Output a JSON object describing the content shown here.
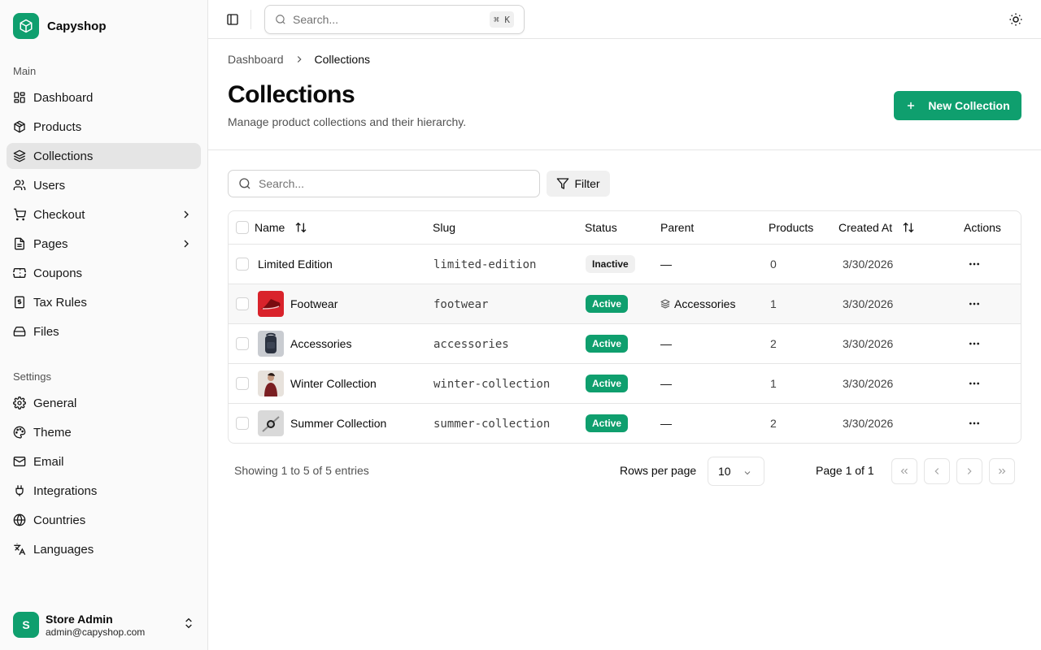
{
  "brand": {
    "name": "Capyshop",
    "color": "#0f9f6e"
  },
  "sidebar": {
    "main_label": "Main",
    "main_items": [
      {
        "label": "Dashboard",
        "icon": "dashboard-icon"
      },
      {
        "label": "Products",
        "icon": "package-icon"
      },
      {
        "label": "Collections",
        "icon": "layers-icon",
        "active": true
      },
      {
        "label": "Users",
        "icon": "users-icon"
      },
      {
        "label": "Checkout",
        "icon": "cart-icon",
        "has_children": true
      },
      {
        "label": "Pages",
        "icon": "file-icon",
        "has_children": true
      },
      {
        "label": "Coupons",
        "icon": "ticket-icon"
      },
      {
        "label": "Tax Rules",
        "icon": "receipt-icon"
      },
      {
        "label": "Files",
        "icon": "hard-drive-icon"
      }
    ],
    "settings_label": "Settings",
    "settings_items": [
      {
        "label": "General",
        "icon": "gear-icon"
      },
      {
        "label": "Theme",
        "icon": "palette-icon"
      },
      {
        "label": "Email",
        "icon": "mail-icon"
      },
      {
        "label": "Integrations",
        "icon": "plug-icon"
      },
      {
        "label": "Countries",
        "icon": "globe-icon"
      },
      {
        "label": "Languages",
        "icon": "languages-icon"
      }
    ],
    "user": {
      "initial": "S",
      "name": "Store Admin",
      "email": "admin@capyshop.com"
    }
  },
  "topbar": {
    "search_placeholder": "Search...",
    "shortcut": "⌘ K"
  },
  "breadcrumb": {
    "root": "Dashboard",
    "current": "Collections"
  },
  "page": {
    "title": "Collections",
    "subtitle": "Manage product collections and their hierarchy.",
    "new_button": "New Collection"
  },
  "toolbar": {
    "search_placeholder": "Search...",
    "filter_label": "Filter"
  },
  "table": {
    "columns": {
      "name": "Name",
      "slug": "Slug",
      "status": "Status",
      "parent": "Parent",
      "products": "Products",
      "created": "Created At",
      "actions": "Actions"
    },
    "rows": [
      {
        "name": "Limited Edition",
        "slug": "limited-edition",
        "status": "Inactive",
        "parent": "—",
        "products": "0",
        "created": "3/30/2026",
        "thumb": "none"
      },
      {
        "name": "Footwear",
        "slug": "footwear",
        "status": "Active",
        "parent": "Accessories",
        "products": "1",
        "created": "3/30/2026",
        "thumb": "red-shoe"
      },
      {
        "name": "Accessories",
        "slug": "accessories",
        "status": "Active",
        "parent": "—",
        "products": "2",
        "created": "3/30/2026",
        "thumb": "backpack"
      },
      {
        "name": "Winter Collection",
        "slug": "winter-collection",
        "status": "Active",
        "parent": "—",
        "products": "1",
        "created": "3/30/2026",
        "thumb": "winter-coat"
      },
      {
        "name": "Summer Collection",
        "slug": "summer-collection",
        "status": "Active",
        "parent": "—",
        "products": "2",
        "created": "3/30/2026",
        "thumb": "watch"
      }
    ]
  },
  "pagination": {
    "showing": "Showing 1 to 5 of 5 entries",
    "rows_per_page_label": "Rows per page",
    "rows_per_page_value": "10",
    "page_info": "Page 1 of 1"
  }
}
